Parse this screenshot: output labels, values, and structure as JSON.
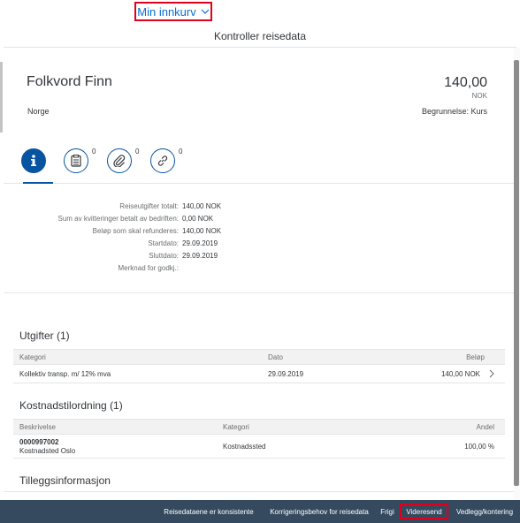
{
  "topbar": {
    "menu_label": "Min innkurv"
  },
  "header": {
    "title": "Kontroller reisedata"
  },
  "object": {
    "name": "Folkvord Finn",
    "amount": "140,00",
    "currency": "NOK",
    "country": "Norge",
    "reason": "Begrunnelse: Kurs"
  },
  "tabs": [
    {
      "icon": "info-icon",
      "count": ""
    },
    {
      "icon": "receipt-icon",
      "count": "0"
    },
    {
      "icon": "paperclip-icon",
      "count": "0"
    },
    {
      "icon": "link-icon",
      "count": "0"
    }
  ],
  "info": [
    {
      "label": "Reiseutgifter totalt:",
      "value": "140,00  NOK"
    },
    {
      "label": "Sum av kvitteringer betalt av bedriften:",
      "value": "0,00  NOK"
    },
    {
      "label": "Beløp som skal refunderes:",
      "value": "140,00  NOK"
    },
    {
      "label": "Startdato:",
      "value": "29.09.2019"
    },
    {
      "label": "Sluttdato:",
      "value": "29.09.2019"
    },
    {
      "label": "Merknad for godkj.:",
      "value": ""
    }
  ],
  "expenses": {
    "title": "Utgifter (1)",
    "columns": [
      "Kategori",
      "Dato",
      "Beløp"
    ],
    "rows": [
      {
        "category": "Kollektiv transp. m/ 12% mva",
        "date": "29.09.2019",
        "amount": "140,00  NOK"
      }
    ]
  },
  "cost_assignment": {
    "title": "Kostnadstilordning (1)",
    "columns": [
      "Beskrivelse",
      "Kategori",
      "Andel"
    ],
    "rows": [
      {
        "code": "0000997002",
        "description": "Kostnadsted Oslo",
        "category": "Kostnadssted",
        "share": "100,00 %"
      }
    ]
  },
  "additional": {
    "title": "Tilleggsinformasjon"
  },
  "footer": {
    "buttons": [
      "Reisedataene er konsistente",
      "Korrigeringsbehov for reisedata",
      "Frigi",
      "Videresend",
      "Vedlegg/kontering"
    ]
  },
  "colors": {
    "accent": "#0854a0",
    "footer_bg": "#354a5f",
    "highlight": "#e0001b"
  }
}
